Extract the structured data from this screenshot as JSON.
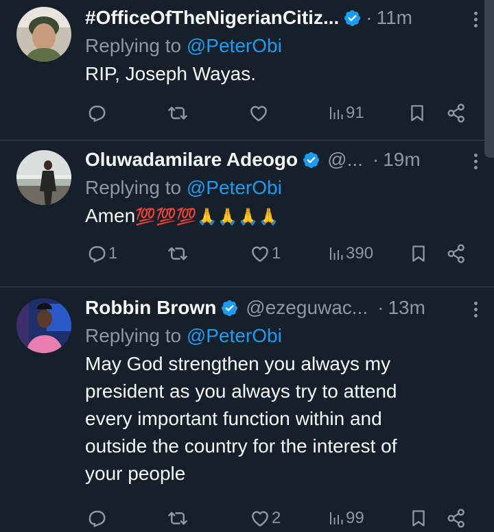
{
  "reply_prefix": "Replying to ",
  "tweets": [
    {
      "name": "#OfficeOfTheNigerianCitiz...",
      "handle": "",
      "time": "11m",
      "reply_to": "@PeterObi",
      "text": "RIP, Joseph Wayas.",
      "replies": "",
      "retweets": "",
      "likes": "",
      "views": "91"
    },
    {
      "name": "Oluwadamilare Adeogo",
      "handle": "@...",
      "time": "19m",
      "reply_to": "@PeterObi",
      "text": "Amen",
      "emoji": "💯💯💯🙏🙏🙏🙏",
      "replies": "1",
      "retweets": "",
      "likes": "1",
      "views": "390"
    },
    {
      "name": "Robbin Brown",
      "handle": "@ezeguwac...",
      "time": "13m",
      "reply_to": "@PeterObi",
      "text_lines": [
        "May God strengthen you always my",
        "president as you always try to attend",
        "every important function within and",
        "outside the country for the interest of",
        "your people"
      ],
      "replies": "",
      "retweets": "",
      "likes": "2",
      "views": "99"
    }
  ],
  "icons": {
    "verified": "verified-badge-icon",
    "reply": "reply-icon",
    "retweet": "retweet-icon",
    "like": "heart-icon",
    "views": "views-chart-icon",
    "bookmark": "bookmark-icon",
    "share": "share-icon",
    "more": "more-vertical-icon"
  },
  "colors": {
    "background": "#15202b",
    "text": "#f7f9f9",
    "muted": "#8b98a5",
    "accent": "#1d9bf0",
    "divider": "#38444d"
  }
}
